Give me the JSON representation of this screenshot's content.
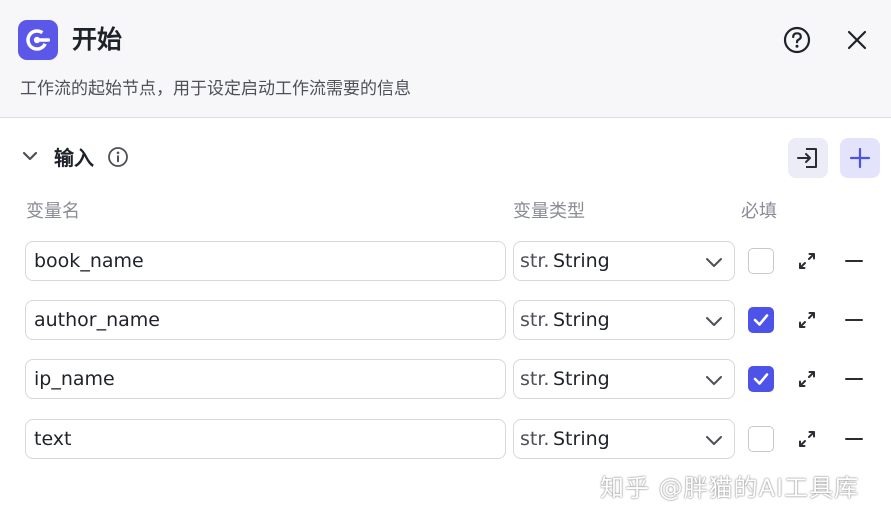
{
  "header": {
    "title": "开始",
    "description": "工作流的起始节点，用于设定启动工作流需要的信息"
  },
  "section": {
    "title": "输入"
  },
  "columns": {
    "name": "变量名",
    "type": "变量类型",
    "required": "必填"
  },
  "rows": [
    {
      "name": "book_name",
      "type_badge": "str.",
      "type": "String",
      "required": false
    },
    {
      "name": "author_name",
      "type_badge": "str.",
      "type": "String",
      "required": true
    },
    {
      "name": "ip_name",
      "type_badge": "str.",
      "type": "String",
      "required": true
    },
    {
      "name": "text",
      "type_badge": "str.",
      "type": "String",
      "required": false
    }
  ],
  "watermark": "知乎 @胖猫的AI工具库",
  "colors": {
    "accent": "#4d53e8",
    "logo": "#5b57e8",
    "header_bg": "#f7f7fa"
  },
  "icons": {
    "logo": "start-node-icon",
    "help": "help-circle-icon",
    "close": "close-icon",
    "collapse": "chevron-down-icon",
    "info": "info-icon",
    "import": "import-icon",
    "add": "plus-icon",
    "expand": "expand-icon",
    "remove": "minus-icon"
  }
}
